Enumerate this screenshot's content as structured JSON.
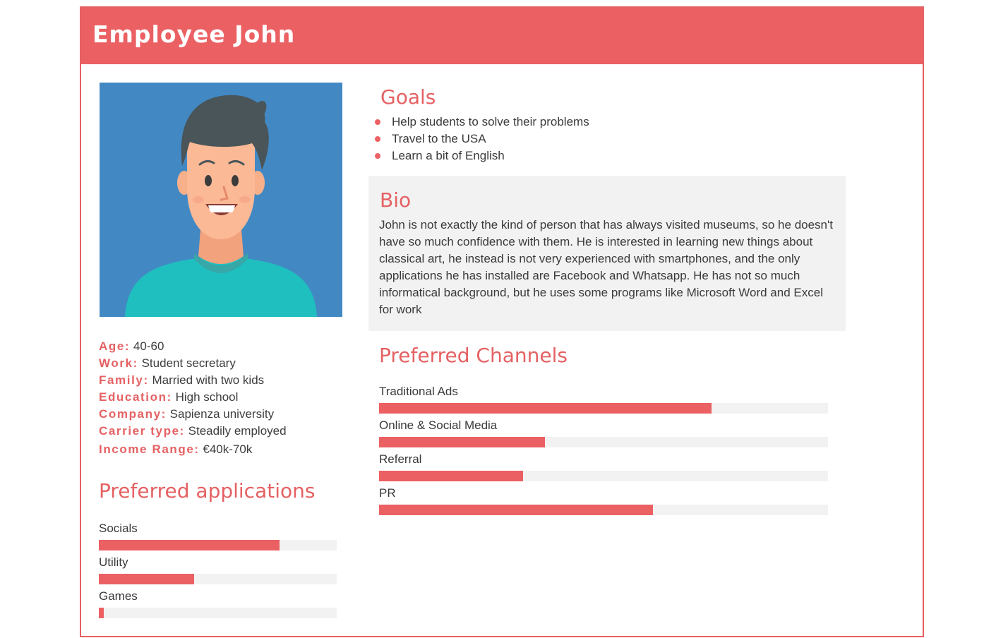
{
  "header": {
    "title": "Employee John"
  },
  "avatar": {
    "icon": "man-avatar-icon",
    "background": "#4289c4"
  },
  "details": [
    {
      "key": "Age:",
      "value": "40-60"
    },
    {
      "key": "Work:",
      "value": "Student secretary"
    },
    {
      "key": "Family:",
      "value": "Married with two kids"
    },
    {
      "key": "Education:",
      "value": "High school"
    },
    {
      "key": "Company:",
      "value": "Sapienza university"
    },
    {
      "key": "Carrier type:",
      "value": "Steadily employed"
    },
    {
      "key": "Income Range:",
      "value": "€40k-70k"
    }
  ],
  "preferred_applications": {
    "title": "Preferred applications",
    "items": [
      {
        "label": "Socials",
        "level": 0.76
      },
      {
        "label": "Utility",
        "level": 0.4
      },
      {
        "label": "Games",
        "level": 0.02
      }
    ]
  },
  "goals": {
    "title": "Goals",
    "items": [
      "Help students to solve their problems",
      "Travel to the USA",
      "Learn a bit of English"
    ]
  },
  "bio": {
    "title": "Bio",
    "text": "John is not exactly the kind of person that has always visited museums, so he doesn't have so much confidence with them. He is interested in learning new things about classical art, he instead is not very experienced with smartphones, and the only applications he has installed are Facebook and Whatsapp. He has not so much informatical background, but he uses some programs like Microsoft Word and Excel for work"
  },
  "preferred_channels": {
    "title": "Preferred Channels",
    "items": [
      {
        "label": "Traditional Ads",
        "level": 0.74
      },
      {
        "label": "Online & Social Media",
        "level": 0.37
      },
      {
        "label": "Referral",
        "level": 0.32
      },
      {
        "label": "PR",
        "level": 0.61
      }
    ]
  },
  "colors": {
    "accent": "#eb6063",
    "track": "#f2f2f2",
    "bio_background": "#f2f2f2",
    "text": "#3a3a3a"
  }
}
